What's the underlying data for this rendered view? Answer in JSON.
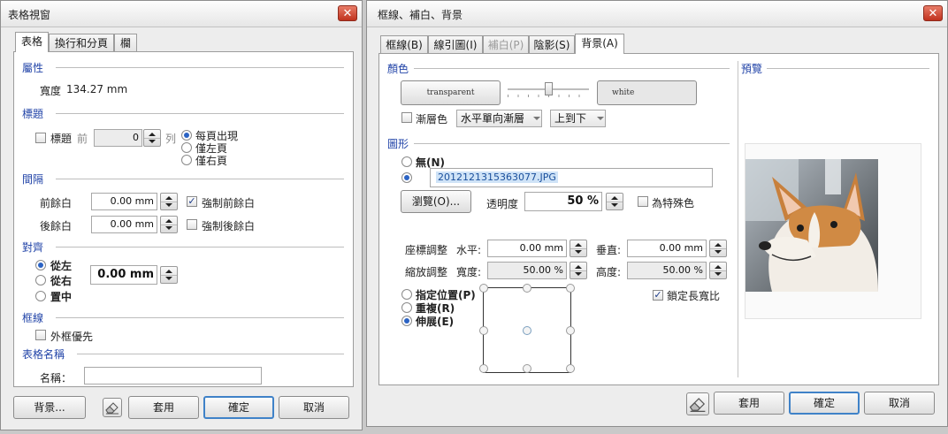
{
  "left_dialog": {
    "title": "表格視窗",
    "close_label": "✕",
    "tabs": [
      {
        "label": "表格",
        "active": true
      },
      {
        "label": "換行和分頁",
        "active": false
      },
      {
        "label": "欄",
        "active": false
      }
    ],
    "properties": {
      "section": "屬性",
      "width_label": "寬度",
      "width_value": "134.27 mm"
    },
    "header": {
      "section": "標題",
      "title_checkbox_label": "標題",
      "before_label": "前",
      "rows_value": "0",
      "rows_unit": "列",
      "options": [
        {
          "label": "每頁出現",
          "selected": true
        },
        {
          "label": "僅左頁",
          "selected": false
        },
        {
          "label": "僅右頁",
          "selected": false
        }
      ]
    },
    "spacing": {
      "section": "間隔",
      "before_label": "前餘白",
      "before_value": "0.00 mm",
      "force_before_label": "強制前餘白",
      "force_before_checked": true,
      "after_label": "後餘白",
      "after_value": "0.00 mm",
      "force_after_label": "強制後餘白",
      "force_after_checked": false
    },
    "align": {
      "section": "對齊",
      "options": [
        {
          "label": "從左",
          "selected": true
        },
        {
          "label": "從右",
          "selected": false
        },
        {
          "label": "置中",
          "selected": false
        }
      ],
      "offset_value": "0.00 mm"
    },
    "border": {
      "section": "框線",
      "outer_priority_label": "外框優先",
      "outer_priority_checked": false
    },
    "table_name": {
      "section": "表格名稱",
      "name_label": "名稱：",
      "name_value": ""
    },
    "buttons": {
      "background": "背景...",
      "apply": "套用",
      "ok": "確定",
      "cancel": "取消"
    }
  },
  "right_dialog": {
    "title": "框線、補白、背景",
    "close_label": "✕",
    "tabs": [
      {
        "label": "框線(B)",
        "active": false,
        "disabled": false
      },
      {
        "label": "線引圖(I)",
        "active": false,
        "disabled": false
      },
      {
        "label": "補白(P)",
        "active": false,
        "disabled": true
      },
      {
        "label": "陰影(S)",
        "active": false,
        "disabled": false
      },
      {
        "label": "背景(A)",
        "active": true,
        "disabled": false
      }
    ],
    "color": {
      "section": "顏色",
      "from_color": "transparent",
      "to_color": "white",
      "gradient_checkbox_label": "漸層色",
      "gradient_checked": false,
      "gradient_type": "水平單向漸層",
      "gradient_direction": "上到下",
      "slider_level": 0.5
    },
    "image": {
      "section": "圖形",
      "none_label": "無(N)",
      "none_selected": false,
      "file_selected": true,
      "file_name": "2012121315363077.JPG",
      "browse_label": "瀏覽(O)...",
      "opacity_label": "透明度",
      "opacity_value": "50 %",
      "special_label": "為特殊色",
      "special_checked": false,
      "coord_label": "座標調整",
      "horizontal_label": "水平:",
      "horizontal_value": "0.00 mm",
      "vertical_label": "垂直:",
      "vertical_value": "0.00 mm",
      "scale_label": "縮放調整",
      "width_label": "寬度:",
      "width_value": "50.00 %",
      "height_label": "高度:",
      "height_value": "50.00 %",
      "placement_options": [
        {
          "label": "指定位置(P)",
          "selected": false
        },
        {
          "label": "重複(R)",
          "selected": false
        },
        {
          "label": "伸展(E)",
          "selected": true
        }
      ],
      "lock_ratio_label": "鎖定長寬比",
      "lock_ratio_checked": true
    },
    "preview": {
      "section": "預覽"
    },
    "buttons": {
      "apply": "套用",
      "ok": "確定",
      "cancel": "取消"
    }
  },
  "colors": {
    "section_blue": "#2244a8",
    "default_button_border": "#3f82c8",
    "close_red": "#c0321e"
  },
  "icons": [
    "close-icon",
    "eraser-icon",
    "spin-up-icon",
    "spin-down-icon",
    "dropdown-arrow-icon",
    "corgi-preview-image"
  ]
}
